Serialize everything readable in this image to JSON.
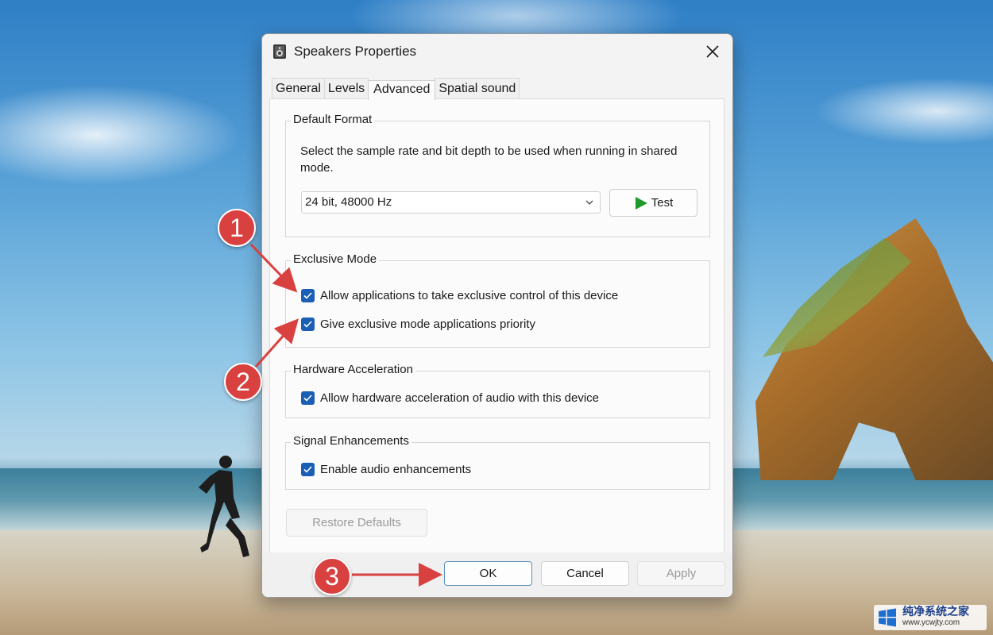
{
  "dialog": {
    "title": "Speakers Properties",
    "tabs": [
      "General",
      "Levels",
      "Advanced",
      "Spatial sound"
    ],
    "active_tab": "Advanced",
    "default_format": {
      "label": "Default Format",
      "description": "Select the sample rate and bit depth to be used when running in shared mode.",
      "selected_format": "24 bit, 48000 Hz",
      "test_label": "Test"
    },
    "exclusive_mode": {
      "label": "Exclusive Mode",
      "allow_exclusive": "Allow applications to take exclusive control of this device",
      "give_priority": "Give exclusive mode applications priority"
    },
    "hardware_acceleration": {
      "label": "Hardware Acceleration",
      "allow_hw": "Allow hardware acceleration of audio with this device"
    },
    "signal_enhancements": {
      "label": "Signal Enhancements",
      "enable_enhancements": "Enable audio enhancements"
    },
    "restore_defaults_label": "Restore Defaults",
    "footer": {
      "ok_label": "OK",
      "cancel_label": "Cancel",
      "apply_label": "Apply"
    }
  },
  "annotations": {
    "step1": "1",
    "step2": "2",
    "step3": "3"
  },
  "watermark": {
    "title": "纯净系统之家",
    "url": "www.ycwjty.com"
  },
  "colors": {
    "checkbox_accent": "#1a5fb4",
    "marker_red": "#d94040",
    "test_icon_green": "#1f9a2a"
  }
}
